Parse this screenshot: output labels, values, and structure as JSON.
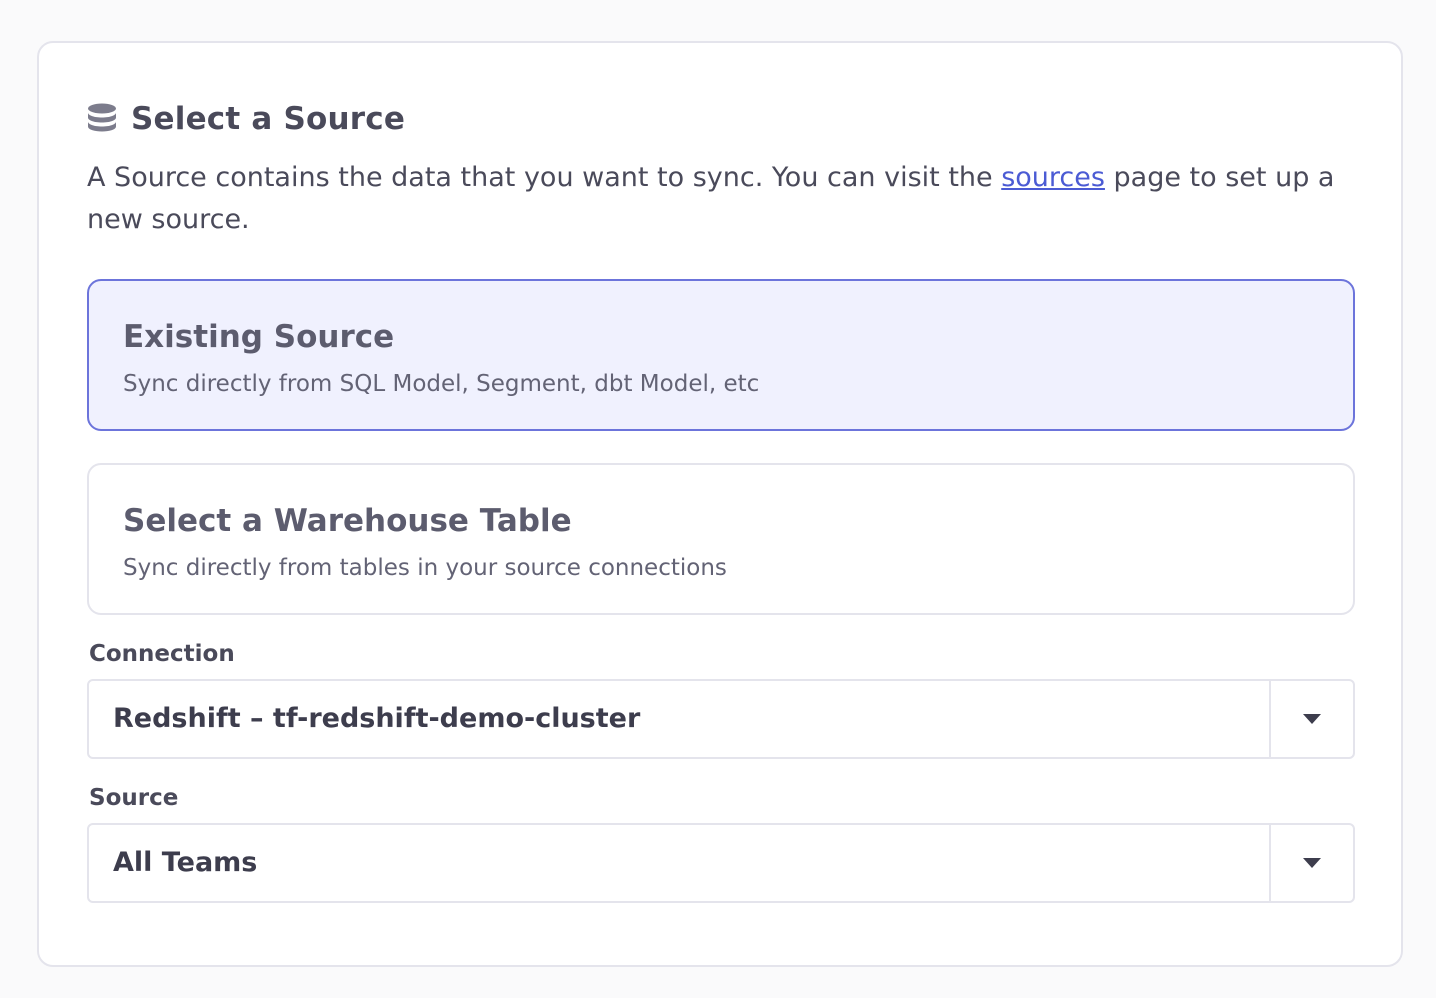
{
  "header": {
    "icon": "database-icon",
    "title": "Select a Source"
  },
  "description": {
    "before": "A Source contains the data that you want to sync. You can visit the ",
    "link": "sources",
    "after": " page to set up a new source."
  },
  "options": [
    {
      "title": "Existing Source",
      "subtitle": "Sync directly from SQL Model, Segment, dbt Model, etc",
      "selected": true
    },
    {
      "title": "Select a Warehouse Table",
      "subtitle": "Sync directly from tables in your source connections",
      "selected": false
    }
  ],
  "connection": {
    "label": "Connection",
    "value": "Redshift – tf-redshift-demo-cluster",
    "icon": "chevron-down-icon"
  },
  "source": {
    "label": "Source",
    "value": "All Teams",
    "icon": "chevron-down-icon"
  },
  "colors": {
    "accent": "#6c74db",
    "selected_bg": "#f0f1fe",
    "link": "#4b5bd4"
  }
}
